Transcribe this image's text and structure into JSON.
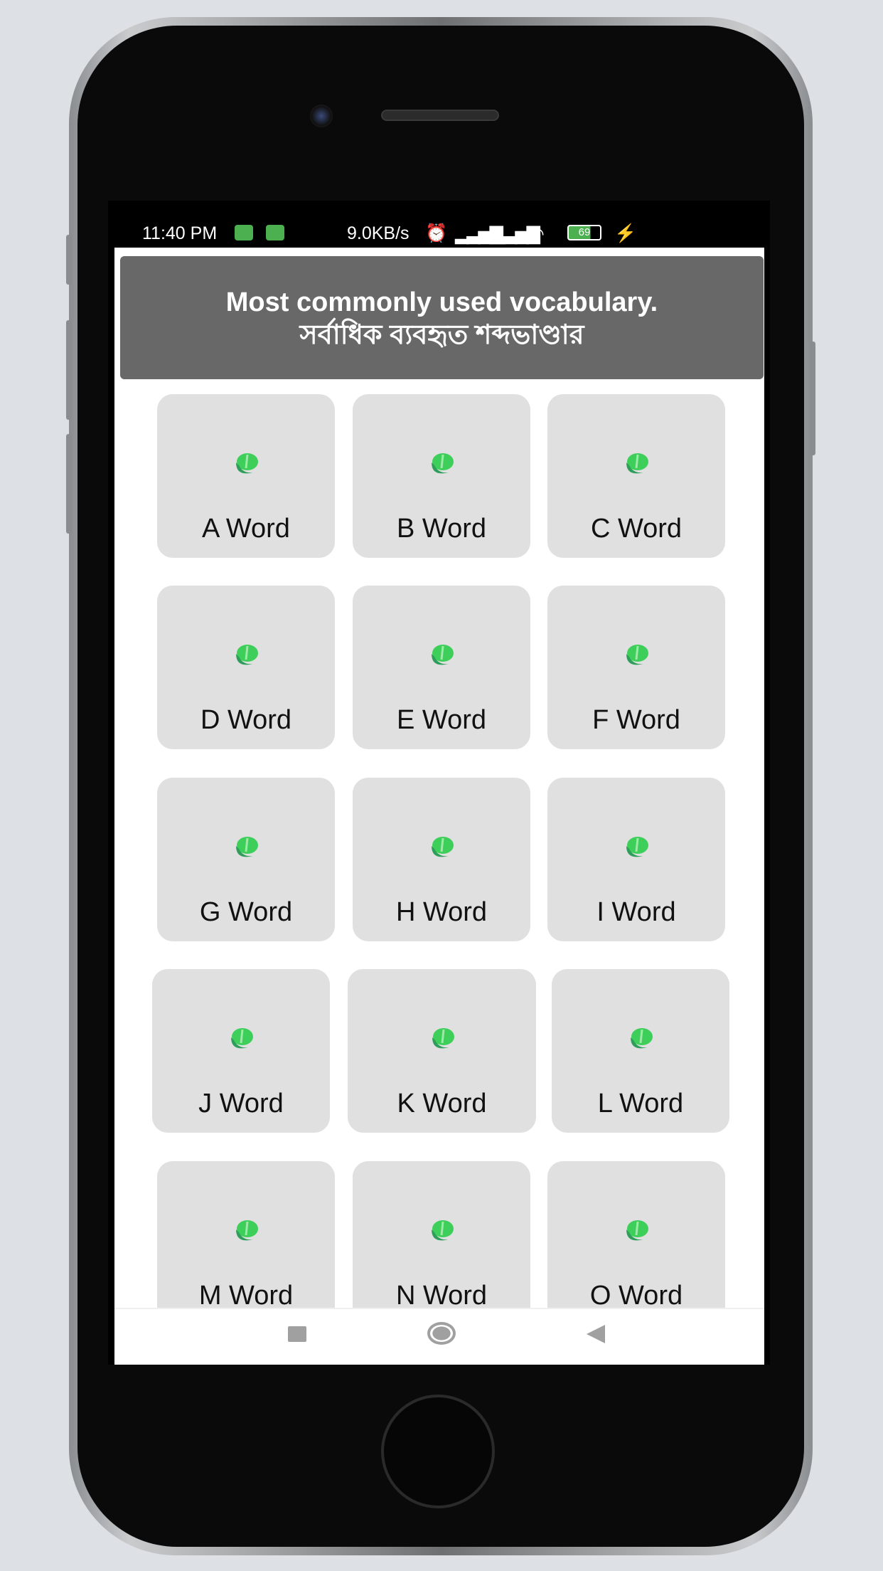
{
  "status_bar": {
    "time": "11:40 PM",
    "speed": "9.0KB/s",
    "battery": "69"
  },
  "header": {
    "title_en": "Most commonly used vocabulary.",
    "title_bn": "সর্বাধিক ব্যবহৃত শব্দভাণ্ডার"
  },
  "tiles": [
    {
      "label": "A Word"
    },
    {
      "label": "B Word"
    },
    {
      "label": "C Word"
    },
    {
      "label": "D Word"
    },
    {
      "label": "E Word"
    },
    {
      "label": "F Word"
    },
    {
      "label": "G Word"
    },
    {
      "label": "H Word"
    },
    {
      "label": "I Word"
    },
    {
      "label": "J Word"
    },
    {
      "label": "K Word"
    },
    {
      "label": "L Word"
    },
    {
      "label": "M Word"
    },
    {
      "label": "N Word"
    },
    {
      "label": "O Word"
    }
  ],
  "colors": {
    "header_bg": "#686868",
    "tile_bg": "#e0e0e0",
    "icon_green": "#3ecf5a"
  },
  "icons": {
    "tile_icon": "green-leaf-hand-icon",
    "nav": [
      "recent-apps-icon",
      "home-icon",
      "back-icon"
    ]
  }
}
